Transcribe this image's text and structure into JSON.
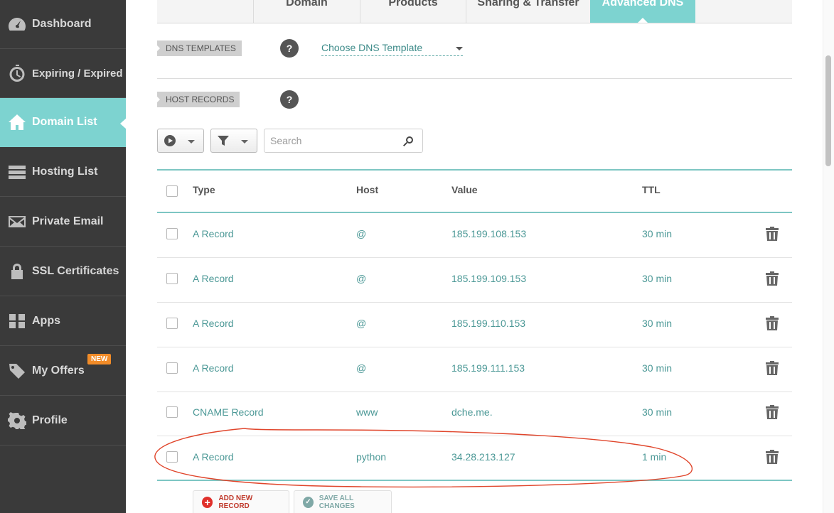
{
  "sidebar": {
    "items": [
      {
        "label": "Dashboard",
        "icon": "dashboard-gauge-icon"
      },
      {
        "label": "Expiring / Expired",
        "icon": "stopwatch-icon"
      },
      {
        "label": "Domain List",
        "icon": "home-icon",
        "active": true
      },
      {
        "label": "Hosting List",
        "icon": "server-icon"
      },
      {
        "label": "Private Email",
        "icon": "envelope-icon"
      },
      {
        "label": "SSL Certificates",
        "icon": "lock-icon"
      },
      {
        "label": "Apps",
        "icon": "apps-grid-icon"
      },
      {
        "label": "My Offers",
        "icon": "tag-icon",
        "badge": "NEW"
      },
      {
        "label": "Profile",
        "icon": "gear-icon"
      }
    ]
  },
  "tabs": [
    {
      "label": "Domain"
    },
    {
      "label": "Products"
    },
    {
      "label": "Sharing & Transfer"
    },
    {
      "label": "Advanced DNS",
      "active": true
    }
  ],
  "dns_templates": {
    "label": "DNS TEMPLATES",
    "help": "?",
    "select_value": "Choose DNS Template"
  },
  "host_records": {
    "label": "HOST RECORDS",
    "help": "?"
  },
  "toolbar": {
    "search_placeholder": "Search"
  },
  "table": {
    "headers": {
      "type": "Type",
      "host": "Host",
      "value": "Value",
      "ttl": "TTL"
    },
    "rows": [
      {
        "type": "A Record",
        "host": "@",
        "value": "185.199.108.153",
        "ttl": "30 min"
      },
      {
        "type": "A Record",
        "host": "@",
        "value": "185.199.109.153",
        "ttl": "30 min"
      },
      {
        "type": "A Record",
        "host": "@",
        "value": "185.199.110.153",
        "ttl": "30 min"
      },
      {
        "type": "A Record",
        "host": "@",
        "value": "185.199.111.153",
        "ttl": "30 min"
      },
      {
        "type": "CNAME Record",
        "host": "www",
        "value": "dche.me.",
        "ttl": "30 min"
      },
      {
        "type": "A Record",
        "host": "python",
        "value": "34.28.213.127",
        "ttl": "1 min",
        "highlighted": true
      }
    ]
  },
  "actions": {
    "add_label": "ADD NEW RECORD",
    "save_label": "SAVE ALL CHANGES"
  },
  "colors": {
    "accent": "#7dd3d0",
    "sidebar_bg": "#3a3a3a",
    "link_text": "#4b9896",
    "badge": "#f28c28",
    "annotation": "#e0452b"
  }
}
